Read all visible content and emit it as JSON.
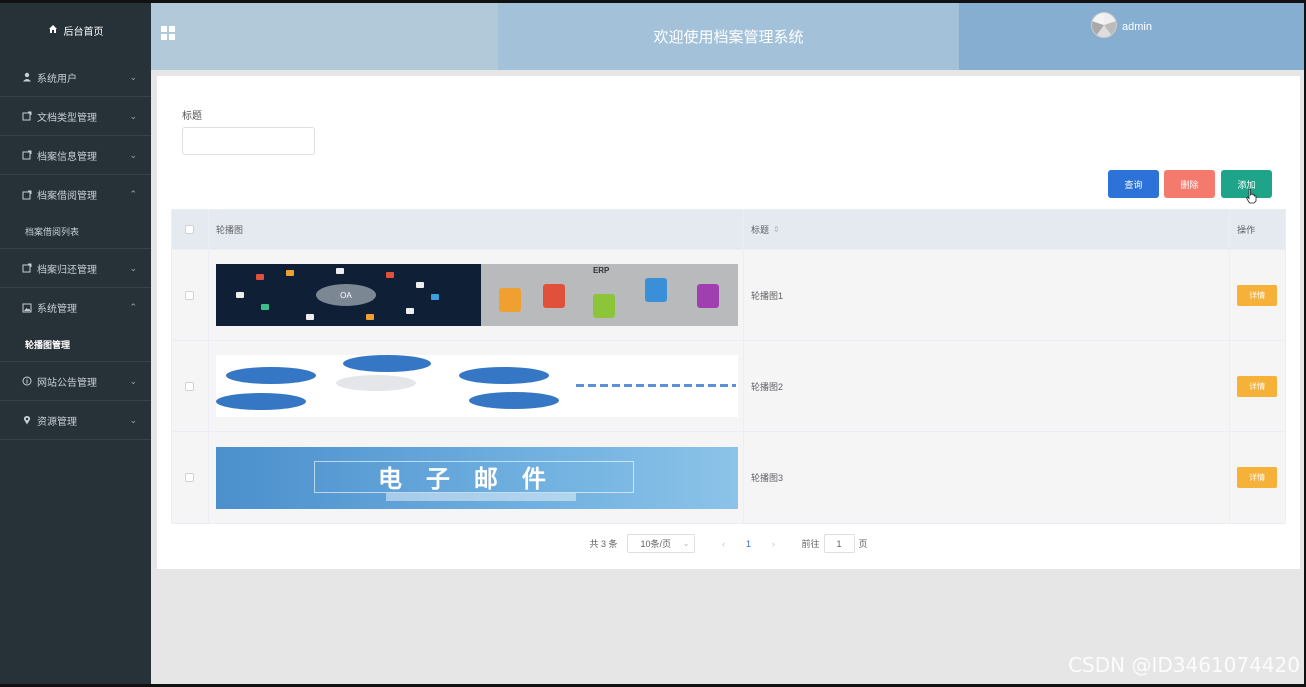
{
  "sidebar": {
    "home_label": "后台首页",
    "items": [
      {
        "label": "系统用户",
        "icon": "user-icon",
        "expanded": false
      },
      {
        "label": "文档类型管理",
        "icon": "document-icon",
        "expanded": false
      },
      {
        "label": "档案信息管理",
        "icon": "document-icon",
        "expanded": false
      },
      {
        "label": "档案借阅管理",
        "icon": "document-icon",
        "expanded": true,
        "children": [
          "档案借阅列表"
        ]
      },
      {
        "label": "档案归还管理",
        "icon": "document-icon",
        "expanded": false
      },
      {
        "label": "系统管理",
        "icon": "image-icon",
        "expanded": true,
        "children": [
          "轮播图管理"
        ]
      },
      {
        "label": "网站公告管理",
        "icon": "info-icon",
        "expanded": false
      },
      {
        "label": "资源管理",
        "icon": "location-icon",
        "expanded": false
      }
    ]
  },
  "header": {
    "title": "欢迎使用档案管理系统",
    "username": "admin"
  },
  "filter": {
    "label": "标题",
    "value": ""
  },
  "actions": {
    "query": "查询",
    "delete": "删除",
    "add": "添加"
  },
  "table": {
    "columns": [
      "轮播图",
      "标题",
      "操作"
    ],
    "rows": [
      {
        "title": "轮播图1",
        "action": "详情",
        "image": "OA / ERP"
      },
      {
        "title": "轮播图2",
        "action": "详情",
        "image": "OA diagram"
      },
      {
        "title": "轮播图3",
        "action": "详情",
        "image": "电子邮件"
      }
    ]
  },
  "banner": {
    "oa_text": "OA",
    "erp_text": "ERP",
    "mail_text": "电子邮件"
  },
  "pager": {
    "total": "共 3 条",
    "page_size": "10条/页",
    "current": "1",
    "goto_label": "前往",
    "goto_value": "1",
    "page_suffix": "页"
  },
  "watermark": "CSDN @ID3461074420",
  "colors": {
    "sidebar_bg": "#263238",
    "query_btn": "#2d72d9",
    "delete_btn": "#f47a6e",
    "add_btn": "#1ea589",
    "detail_btn": "#f6b139"
  }
}
